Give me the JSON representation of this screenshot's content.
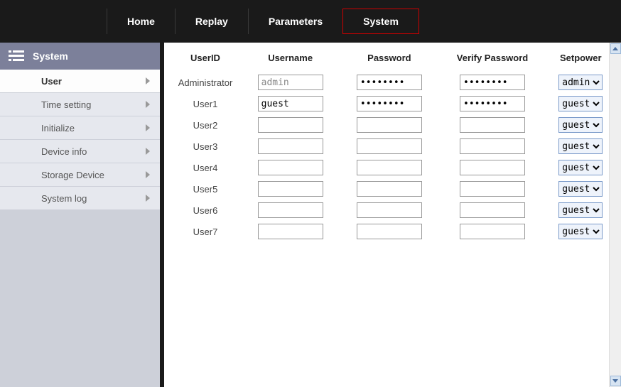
{
  "nav": {
    "items": [
      {
        "label": "Home",
        "active": false
      },
      {
        "label": "Replay",
        "active": false
      },
      {
        "label": "Parameters",
        "active": false
      },
      {
        "label": "System",
        "active": true
      }
    ]
  },
  "sidebar": {
    "title": "System",
    "items": [
      {
        "label": "User",
        "active": true
      },
      {
        "label": "Time setting",
        "active": false
      },
      {
        "label": "Initialize",
        "active": false
      },
      {
        "label": "Device info",
        "active": false
      },
      {
        "label": "Storage Device",
        "active": false
      },
      {
        "label": "System log",
        "active": false
      }
    ]
  },
  "table": {
    "headers": {
      "uid": "UserID",
      "uname": "Username",
      "pw": "Password",
      "vpw": "Verify Password",
      "sp": "Setpower"
    },
    "rows": [
      {
        "uid": "Administrator",
        "uname": "admin",
        "uname_ro": true,
        "pw": "●●●●●●●●",
        "vpw": "●●●●●●●●",
        "sp": "admin"
      },
      {
        "uid": "User1",
        "uname": "guest",
        "uname_ro": false,
        "pw": "●●●●●●●●",
        "vpw": "●●●●●●●●",
        "sp": "guest"
      },
      {
        "uid": "User2",
        "uname": "",
        "uname_ro": false,
        "pw": "",
        "vpw": "",
        "sp": "guest"
      },
      {
        "uid": "User3",
        "uname": "",
        "uname_ro": false,
        "pw": "",
        "vpw": "",
        "sp": "guest"
      },
      {
        "uid": "User4",
        "uname": "",
        "uname_ro": false,
        "pw": "",
        "vpw": "",
        "sp": "guest"
      },
      {
        "uid": "User5",
        "uname": "",
        "uname_ro": false,
        "pw": "",
        "vpw": "",
        "sp": "guest"
      },
      {
        "uid": "User6",
        "uname": "",
        "uname_ro": false,
        "pw": "",
        "vpw": "",
        "sp": "guest"
      },
      {
        "uid": "User7",
        "uname": "",
        "uname_ro": false,
        "pw": "",
        "vpw": "",
        "sp": "guest"
      }
    ],
    "options": [
      "admin",
      "guest"
    ]
  }
}
